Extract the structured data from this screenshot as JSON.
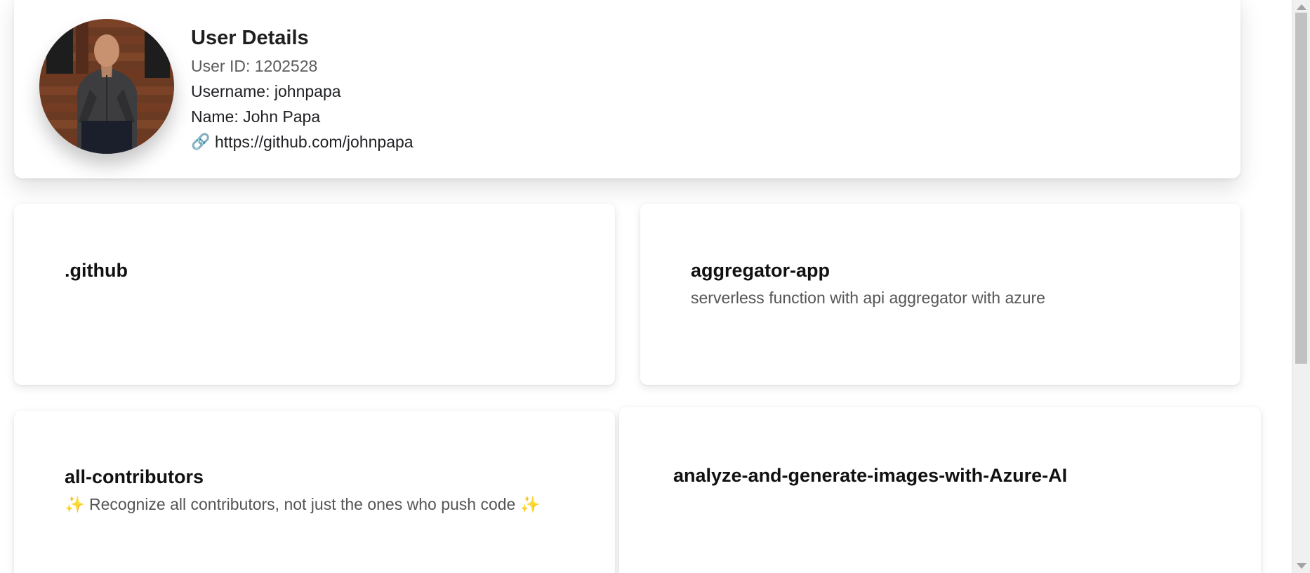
{
  "profile": {
    "heading": "User Details",
    "user_id": "User ID: 1202528",
    "username": "Username: johnpapa",
    "name": "Name: John Papa",
    "url": "https://github.com/johnpapa",
    "avatar_alt": "John Papa profile photo",
    "link_icon": "link-icon"
  },
  "repos": [
    {
      "title": ".github",
      "description": ""
    },
    {
      "title": "aggregator-app",
      "description": "serverless function with api aggregator with azure"
    },
    {
      "title": "all-contributors",
      "description": "✨ Recognize all contributors, not just the ones who push code ✨"
    },
    {
      "title": "analyze-and-generate-images-with-Azure-AI",
      "description": ""
    }
  ],
  "colors": {
    "background": "#ffffff",
    "card": "#ffffff",
    "muted_text": "#555555",
    "scrollbar": "#f0f0f0",
    "scroll_thumb": "#c1c1c1"
  }
}
